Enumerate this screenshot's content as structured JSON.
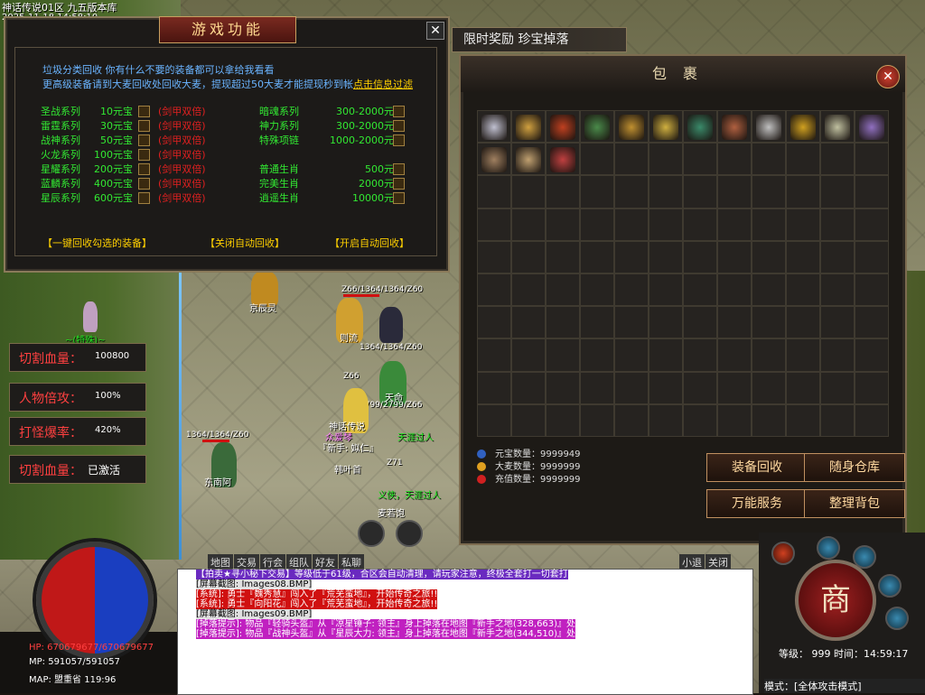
{
  "server": "神话传说01区 九五版本库",
  "timestamp": "2025-11-18 14:58:10",
  "game_function": {
    "title": "游戏功能",
    "intro1": "垃圾分类回收 你有什么不要的装备都可以拿给我看看",
    "intro2": "更高级装备请到大麦回收处回收大麦，提现超过50大麦才能提现秒到帐",
    "intro2_link": "点击信息过滤",
    "left_categories": [
      {
        "name": "圣战系列",
        "price": "10元宝",
        "tag": "(剑甲双倍)"
      },
      {
        "name": "雷霆系列",
        "price": "30元宝",
        "tag": "(剑甲双倍)"
      },
      {
        "name": "战神系列",
        "price": "50元宝",
        "tag": "(剑甲双倍)"
      },
      {
        "name": "火龙系列",
        "price": "100元宝",
        "tag": "(剑甲双倍)"
      },
      {
        "name": "星耀系列",
        "price": "200元宝",
        "tag": "(剑甲双倍)"
      },
      {
        "name": "蓝麟系列",
        "price": "400元宝",
        "tag": "(剑甲双倍)"
      },
      {
        "name": "星辰系列",
        "price": "600元宝",
        "tag": "(剑甲双倍)"
      }
    ],
    "right_categories": [
      {
        "name": "暗魂系列",
        "price": "300-2000元宝"
      },
      {
        "name": "神力系列",
        "price": "300-2000元宝"
      },
      {
        "name": "特殊项链",
        "price": "1000-2000元宝"
      },
      {
        "name": "",
        "price": ""
      },
      {
        "name": "普通生肖",
        "price": "500元宝"
      },
      {
        "name": "完美生肖",
        "price": "2000元宝"
      },
      {
        "name": "逍遥生肖",
        "price": "10000元宝"
      }
    ],
    "action_recycle": "【一键回收勾选的装备】",
    "action_off": "【关闭自动回收】",
    "action_on": "【开启自动回收】"
  },
  "banner": "限时奖励 珍宝掉落",
  "bag": {
    "title": "包裹",
    "items": [
      {
        "icon": "sword-icon",
        "color": "#c0c0d0"
      },
      {
        "icon": "sword-icon",
        "color": "#d0a040"
      },
      {
        "icon": "sword-icon",
        "color": "#c04020"
      },
      {
        "icon": "armor-icon",
        "color": "#4a8a4a"
      },
      {
        "icon": "armor-icon",
        "color": "#c09030"
      },
      {
        "icon": "armor-icon",
        "color": "#d0b040"
      },
      {
        "icon": "necklace-icon",
        "color": "#3a8a6a"
      },
      {
        "icon": "bracelet-icon",
        "color": "#b06040"
      },
      {
        "icon": "helmet-icon",
        "color": "#c0c0c0"
      },
      {
        "icon": "ring-icon",
        "color": "#d0a020"
      },
      {
        "icon": "ring-icon",
        "color": "#c0c0a0"
      },
      {
        "icon": "boots-icon",
        "color": "#9070c0"
      },
      {
        "icon": "gloves-icon",
        "color": "#a08060"
      },
      {
        "icon": "gloves-icon",
        "color": "#c0a070"
      },
      {
        "icon": "belt-icon",
        "color": "#c04040"
      }
    ],
    "currency": [
      {
        "label": "元宝数量：9999949",
        "color": "#3060c0"
      },
      {
        "label": "大麦数量：9999999",
        "color": "#e0a020"
      },
      {
        "label": "充值数量：9999999",
        "color": "#d02020"
      }
    ],
    "btn_recycle": "装备回收",
    "btn_storage": "随身仓库",
    "btn_service": "万能服务",
    "btn_sort": "整理背包"
  },
  "stats": [
    {
      "label": "切割血量：",
      "value": "100800"
    },
    {
      "label": "人物倍攻：",
      "value": "100%"
    },
    {
      "label": "打怪爆率：",
      "value": "420%"
    },
    {
      "label": "切割血量：",
      "value": "已激活"
    }
  ],
  "hud": {
    "hp": "HP: 670679677/670679677",
    "mp": "MP: 591057/591057",
    "map": "MAP: 盟重省 119:96",
    "level": "等级： 999 时间：14:59:17",
    "mode": "模式：[全体攻击模式]",
    "shop": "商",
    "chat_tabs": [
      "地图",
      "交易",
      "行会",
      "组队",
      "好友",
      "私聊"
    ],
    "chat_right_tabs": [
      "小退",
      "关闭"
    ],
    "chat": [
      {
        "text": "【拍卖★寻小秘下交易】等级低于61级，合区会自动清理，请玩家注意，终极全套打一切套打",
        "color": "#fff",
        "bg": "#6a2ac0"
      },
      {
        "text": "[屏幕截图: Images08.BMP]",
        "color": "#000",
        "bg": "#e0e0e0"
      },
      {
        "text": "[系统]: 勇士『魏秀慧』闯入了『荒芜蛮地』，开始传奇之旅!!",
        "color": "#fff",
        "bg": "#d01010"
      },
      {
        "text": "[系统]: 勇士『向阳花』闯入了『荒芜蛮地』，开始传奇之旅!!",
        "color": "#fff",
        "bg": "#d01010"
      },
      {
        "text": "[屏幕截图: Images09.BMP]",
        "color": "#000",
        "bg": "#e0e0e0"
      },
      {
        "text": "[掉落提示]: 物品『轻骑头盔』从『凉星锤子: 领主』身上掉落在地图『新手之地(328,663)』处",
        "color": "#fff",
        "bg": "#c020c0"
      },
      {
        "text": "[掉落提示]: 物品『战神头盔』从『星辰大力: 领主』身上掉落在地图『新手之地(344,510)』处",
        "color": "#fff",
        "bg": "#c020c0"
      }
    ]
  },
  "world_labels": {
    "npc1": "~(特殊)~",
    "player_main": "神话传说",
    "player_main2": "『新手: 姒仁』",
    "player_main3": "众爱琴",
    "name1": "京辰灵",
    "name2": "则流",
    "name3": "天命",
    "name4": "东南阿",
    "name5": "韩叶首",
    "name6": "麦若饱",
    "hp1": "Z66/1364/1364/Z60",
    "hp2": "1364/1364/Z60",
    "hp3": "Z66",
    "hp4": "2799/2799/Z66",
    "hp5": "1364/1364/Z60",
    "hp6": "Z71",
    "slogan1": "天涯过人",
    "slogan2": "义侠，天涯过人"
  },
  "colors": {
    "accent": "#ffd000",
    "panel_border": "#8a7a5a"
  }
}
